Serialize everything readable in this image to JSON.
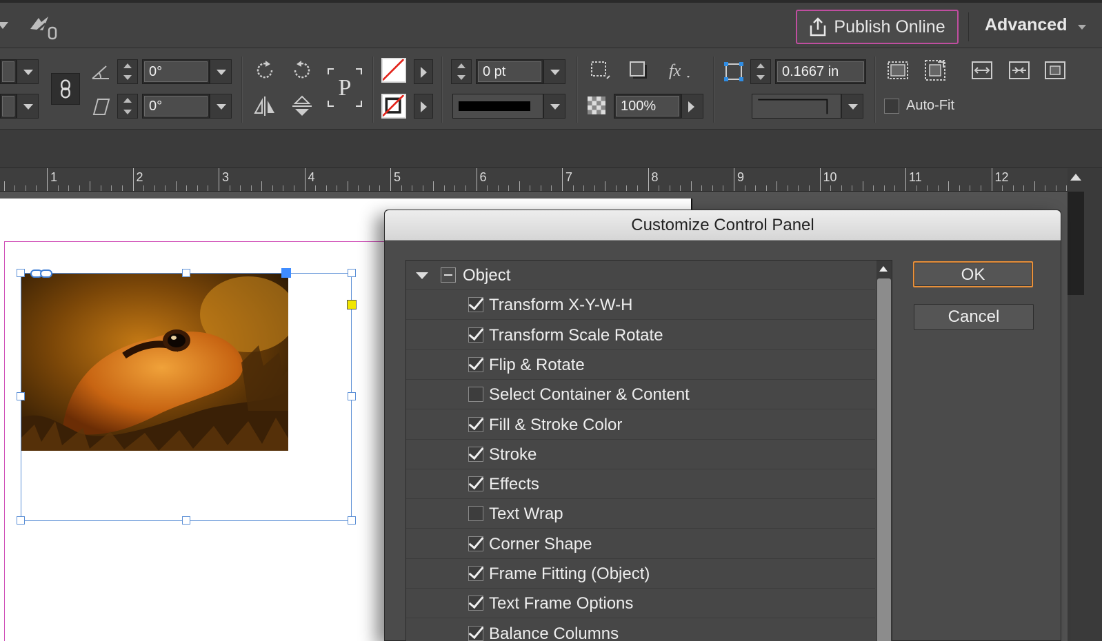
{
  "app_bar": {
    "publish_label": "Publish Online",
    "workspace_label": "Advanced"
  },
  "control_panel": {
    "rotation_angle": "0°",
    "shear_angle": "0°",
    "stroke_weight": "0 pt",
    "opacity": "100%",
    "corner_size": "0.1667 in",
    "auto_fit_label": "Auto-Fit",
    "auto_fit_checked": false
  },
  "ruler": {
    "labels": [
      "1",
      "2",
      "3",
      "4",
      "5",
      "6",
      "7",
      "8",
      "9",
      "10",
      "11",
      "12"
    ]
  },
  "dialog": {
    "title": "Customize Control Panel",
    "group": {
      "label": "Object",
      "expanded": true
    },
    "items": [
      {
        "label": "Transform X-Y-W-H",
        "checked": true
      },
      {
        "label": "Transform Scale Rotate",
        "checked": true
      },
      {
        "label": "Flip & Rotate",
        "checked": true
      },
      {
        "label": "Select Container & Content",
        "checked": false
      },
      {
        "label": "Fill & Stroke Color",
        "checked": true
      },
      {
        "label": "Stroke",
        "checked": true
      },
      {
        "label": "Effects",
        "checked": true
      },
      {
        "label": "Text Wrap",
        "checked": false
      },
      {
        "label": "Corner Shape",
        "checked": true
      },
      {
        "label": "Frame Fitting (Object)",
        "checked": true
      },
      {
        "label": "Text Frame Options",
        "checked": true
      },
      {
        "label": "Balance Columns",
        "checked": true
      }
    ],
    "ok_label": "OK",
    "cancel_label": "Cancel"
  },
  "colors": {
    "publish_outline": "#c04ea0",
    "ok_outline": "#e8903a",
    "margin_guide": "#d04fb8",
    "frame_edge": "#5b8fd6"
  }
}
